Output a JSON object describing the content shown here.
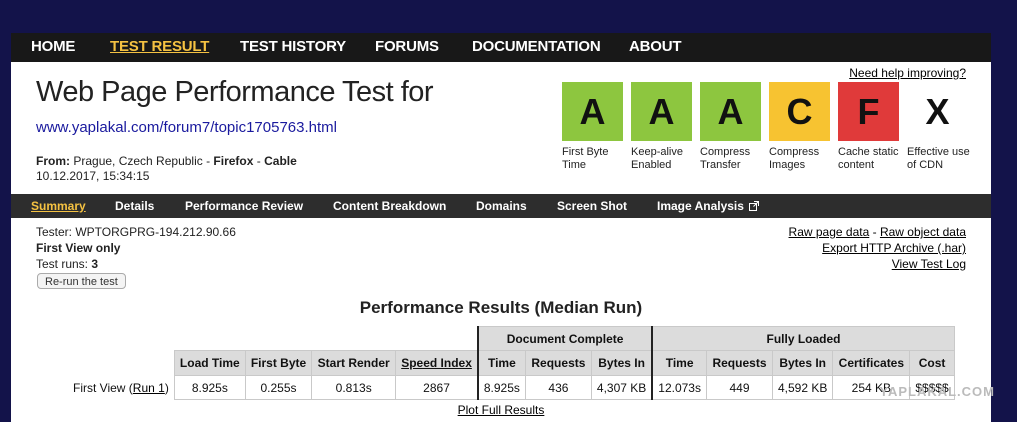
{
  "nav": [
    "HOME",
    "TEST RESULT",
    "TEST HISTORY",
    "FORUMS",
    "DOCUMENTATION",
    "ABOUT"
  ],
  "header": {
    "title": "Web Page Performance Test for",
    "url": "www.yaplakal.com/forum7/topic1705763.html",
    "from_label": "From:",
    "location": "Prague, Czech Republic - ",
    "browser": "Firefox",
    "dash": " - ",
    "connection": "Cable",
    "date": "10.12.2017, 15:34:15",
    "help": "Need help improving?"
  },
  "grades": [
    {
      "grade": "A",
      "label": "First Byte Time",
      "color": "#8dc63f"
    },
    {
      "grade": "A",
      "label": "Keep-alive Enabled",
      "color": "#8dc63f"
    },
    {
      "grade": "A",
      "label": "Compress Transfer",
      "color": "#8dc63f"
    },
    {
      "grade": "C",
      "label": "Compress Images",
      "color": "#f7c331"
    },
    {
      "grade": "F",
      "label": "Cache static content",
      "color": "#e03a3a"
    },
    {
      "grade": "X",
      "label": "Effective use of CDN",
      "color": "#ffffff"
    }
  ],
  "tabs": [
    "Summary",
    "Details",
    "Performance Review",
    "Content Breakdown",
    "Domains",
    "Screen Shot",
    "Image Analysis"
  ],
  "info": {
    "tester": "Tester: WPTORGPRG-194.212.90.66",
    "first_view": "First View only",
    "runs_label": "Test runs: ",
    "runs": "3",
    "rerun": "Re-run the test"
  },
  "links": {
    "raw_page": "Raw page data",
    "sep": " - ",
    "raw_object": "Raw object data",
    "export": "Export HTTP Archive (.har)",
    "view_log": "View Test Log"
  },
  "results": {
    "title": "Performance Results (Median Run)",
    "group_doc": "Document Complete",
    "group_full": "Fully Loaded",
    "headers": [
      "Load Time",
      "First Byte",
      "Start Render",
      "Speed Index",
      "Time",
      "Requests",
      "Bytes In",
      "Time",
      "Requests",
      "Bytes In",
      "Certificates",
      "Cost"
    ],
    "row_label": "First View (",
    "run_link": "Run 1",
    "row_close": ")",
    "values": [
      "8.925s",
      "0.255s",
      "0.813s",
      "2867",
      "8.925s",
      "436",
      "4,307 KB",
      "12.073s",
      "449",
      "4,592 KB",
      "254 KB",
      "$$$$$"
    ],
    "plot_full": "Plot Full Results"
  },
  "watermark": "YAPLAKAL.COM"
}
